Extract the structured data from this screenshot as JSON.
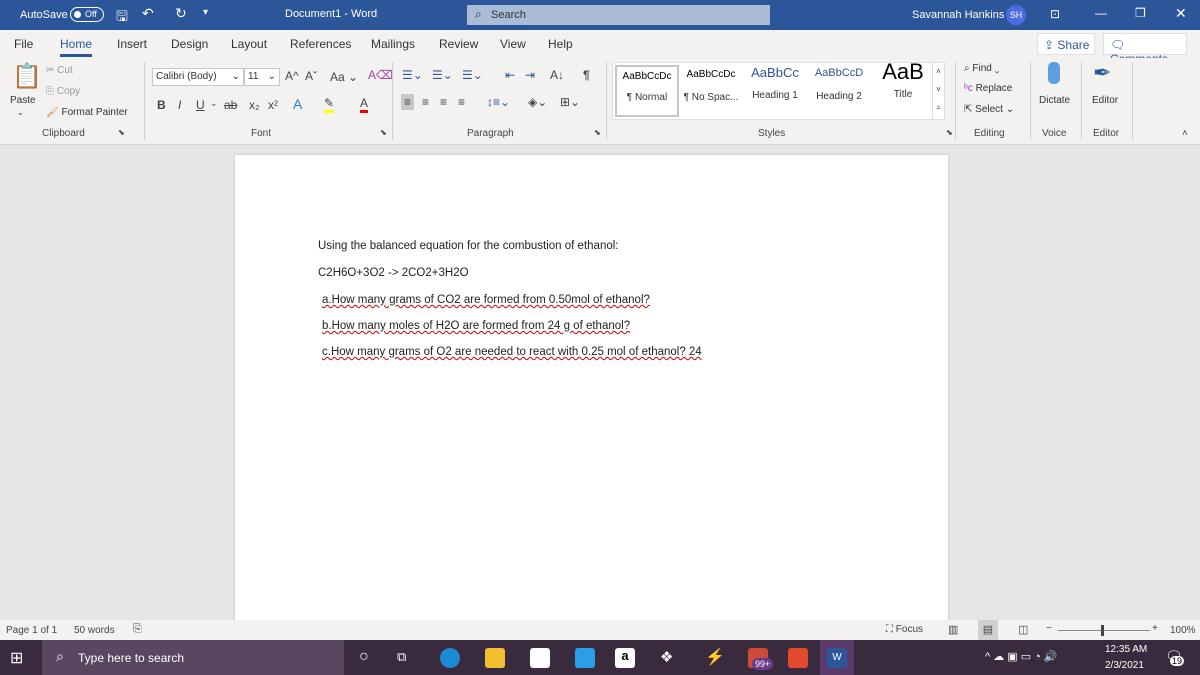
{
  "titlebar": {
    "autosave": "AutoSave",
    "autosave_state": "Off",
    "title": "Document1  -  Word",
    "search": "Search",
    "user": "Savannah Hankins",
    "initials": "SH"
  },
  "tabs": [
    "File",
    "Home",
    "Insert",
    "Design",
    "Layout",
    "References",
    "Mailings",
    "Review",
    "View",
    "Help"
  ],
  "share": "Share",
  "comments": "Comments",
  "clipboard": {
    "paste": "Paste",
    "cut": "Cut",
    "copy": "Copy",
    "format_painter": "Format Painter",
    "label": "Clipboard"
  },
  "font": {
    "name": "Calibri (Body)",
    "size": "11",
    "label": "Font",
    "case": "Aa"
  },
  "paragraph": {
    "label": "Paragraph"
  },
  "styles": {
    "label": "Styles",
    "items": [
      {
        "preview": "AaBbCcDc",
        "name": "¶ Normal"
      },
      {
        "preview": "AaBbCcDc",
        "name": "¶ No Spac..."
      },
      {
        "preview": "AaBbCc",
        "name": "Heading 1"
      },
      {
        "preview": "AaBbCcD",
        "name": "Heading 2"
      },
      {
        "preview": "AaB",
        "name": "Title"
      }
    ]
  },
  "editing": {
    "find": "Find",
    "replace": "Replace",
    "select": "Select",
    "label": "Editing"
  },
  "voice": {
    "dictate": "Dictate",
    "label": "Voice"
  },
  "editor": {
    "button": "Editor",
    "label": "Editor"
  },
  "document": {
    "lines": [
      "Using the balanced equation for the combustion of ethanol:",
      "C2H6O+3O2 -> 2CO2+3H2O",
      "a.How many grams of CO2 are formed from 0.50mol of ethanol?",
      "b.How many moles of H2O are formed from 24 g of ethanol?",
      "c.How many grams of O2 are needed to react with 0.25 mol of ethanol? 24"
    ]
  },
  "status": {
    "page": "Page 1 of 1",
    "words": "50 words",
    "focus": "Focus",
    "zoom": "100%",
    "zoom_value": 100
  },
  "taskbar": {
    "search": "Type here to search",
    "time": "12:35 AM",
    "date": "2/3/2021",
    "badge": "99+",
    "notifications": "19"
  },
  "colors": {
    "brand": "#2b579a",
    "taskbar": "#3a2a3e"
  }
}
